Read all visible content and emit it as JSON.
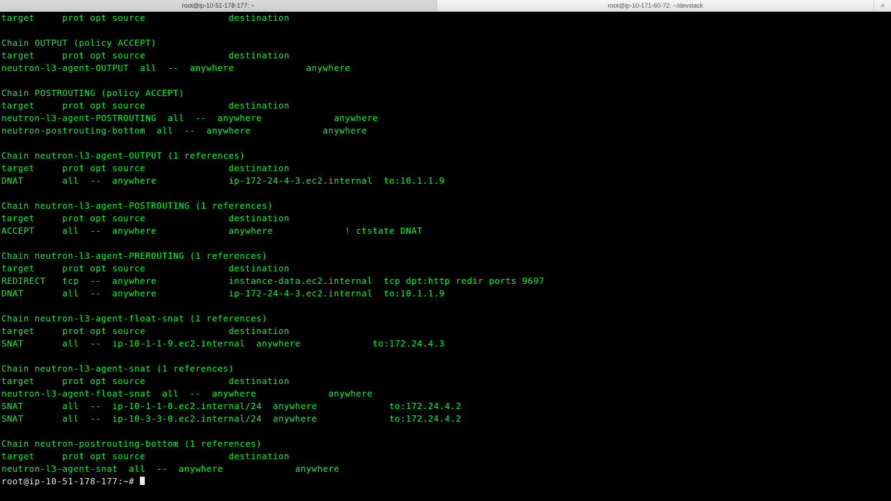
{
  "tabs": {
    "active": "root@ip-10-51-178-177: ~",
    "inactive": "root@ip-10-171-60-72: ~/devstack",
    "plus": "+"
  },
  "prompt": "root@ip-10-51-178-177:~# ",
  "blocks": [
    {
      "lines": [
        "target     prot opt source               destination"
      ]
    },
    {
      "lines": [
        "Chain OUTPUT (policy ACCEPT)",
        "target     prot opt source               destination",
        "neutron-l3-agent-OUTPUT  all  --  anywhere             anywhere"
      ]
    },
    {
      "lines": [
        "Chain POSTROUTING (policy ACCEPT)",
        "target     prot opt source               destination",
        "neutron-l3-agent-POSTROUTING  all  --  anywhere             anywhere",
        "neutron-postrouting-bottom  all  --  anywhere             anywhere"
      ]
    },
    {
      "lines": [
        "Chain neutron-l3-agent-OUTPUT (1 references)",
        "target     prot opt source               destination",
        "DNAT       all  --  anywhere             ip-172-24-4-3.ec2.internal  to:10.1.1.9"
      ]
    },
    {
      "lines": [
        "Chain neutron-l3-agent-POSTROUTING (1 references)",
        "target     prot opt source               destination",
        "ACCEPT     all  --  anywhere             anywhere             ! ctstate DNAT"
      ]
    },
    {
      "lines": [
        "Chain neutron-l3-agent-PREROUTING (1 references)",
        "target     prot opt source               destination",
        "REDIRECT   tcp  --  anywhere             instance-data.ec2.internal  tcp dpt:http redir ports 9697",
        "DNAT       all  --  anywhere             ip-172-24-4-3.ec2.internal  to:10.1.1.9"
      ]
    },
    {
      "lines": [
        "Chain neutron-l3-agent-float-snat (1 references)",
        "target     prot opt source               destination",
        "SNAT       all  --  ip-10-1-1-9.ec2.internal  anywhere             to:172.24.4.3"
      ]
    },
    {
      "lines": [
        "Chain neutron-l3-agent-snat (1 references)",
        "target     prot opt source               destination",
        "neutron-l3-agent-float-snat  all  --  anywhere             anywhere",
        "SNAT       all  --  ip-10-1-1-0.ec2.internal/24  anywhere             to:172.24.4.2",
        "SNAT       all  --  ip-10-3-3-0.ec2.internal/24  anywhere             to:172.24.4.2"
      ]
    },
    {
      "lines": [
        "Chain neutron-postrouting-bottom (1 references)",
        "target     prot opt source               destination",
        "neutron-l3-agent-snat  all  --  anywhere             anywhere"
      ]
    }
  ]
}
